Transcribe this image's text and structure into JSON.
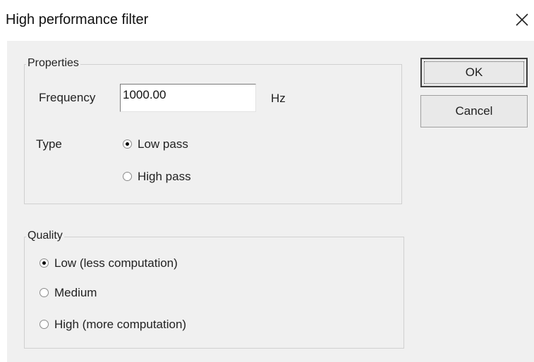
{
  "window": {
    "title": "High performance filter",
    "close_icon": "close-icon"
  },
  "properties": {
    "legend": "Properties",
    "frequency_label": "Frequency",
    "frequency_value": "1000.00",
    "frequency_unit": "Hz",
    "type_label": "Type",
    "type_options": [
      {
        "label": "Low pass",
        "selected": true
      },
      {
        "label": "High pass",
        "selected": false
      }
    ]
  },
  "quality": {
    "legend": "Quality",
    "options": [
      {
        "label": "Low (less computation)",
        "selected": true
      },
      {
        "label": "Medium",
        "selected": false
      },
      {
        "label": "High (more computation)",
        "selected": false
      }
    ]
  },
  "buttons": {
    "ok_label": "OK",
    "cancel_label": "Cancel"
  }
}
